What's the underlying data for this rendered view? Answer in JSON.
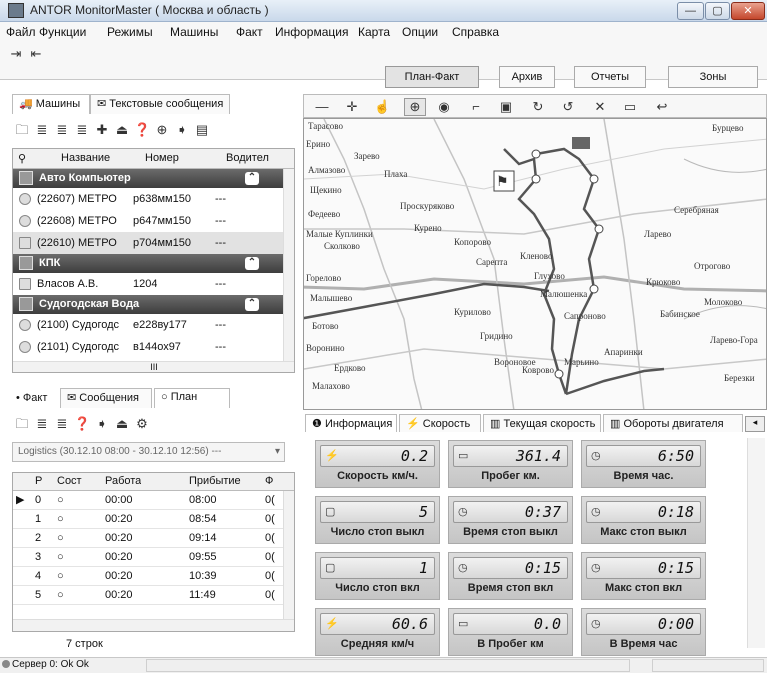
{
  "window": {
    "title": "ANTOR MonitorMaster ( Москва и область )"
  },
  "menu": [
    "Файл",
    "Функции",
    "Режимы",
    "Машины",
    "Факт",
    "Информация",
    "Карта",
    "Опции",
    "Справка"
  ],
  "view_tabs": [
    "План-Факт",
    "Архив",
    "Отчеты",
    "Зоны"
  ],
  "vehicles_panel": {
    "tabs": [
      "Машины",
      "Текстовые сообщения"
    ],
    "columns": [
      "Название",
      "Номер",
      "Водител"
    ],
    "groups": [
      {
        "name": "Авто Компьютер",
        "rows": [
          {
            "name": "(22607) МЕТРО",
            "number": "р638мм150",
            "driver": "---"
          },
          {
            "name": "(22608) МЕТРО",
            "number": "р647мм150",
            "driver": "---"
          },
          {
            "name": "(22610) МЕТРО",
            "number": "р704мм150",
            "driver": "---"
          }
        ]
      },
      {
        "name": "КПК",
        "rows": [
          {
            "name": "Власов А.В.",
            "number": "1204",
            "driver": "---"
          }
        ]
      },
      {
        "name": "Судогодская Вода",
        "rows": [
          {
            "name": "(2100) Судогодс",
            "number": "е228ву177",
            "driver": "---"
          },
          {
            "name": "(2101) Судогодс",
            "number": "в144ох97",
            "driver": "---"
          }
        ]
      }
    ],
    "scroll_marker": "III"
  },
  "plan_panel": {
    "tabs": [
      "Факт",
      "Сообщения",
      "План"
    ],
    "route_select": "Logistics (30.12.10 08:00 - 30.12.10 12:56) ---",
    "columns": [
      "Р",
      "Сост",
      "Работа",
      "Прибытие",
      "Ф"
    ],
    "rows": [
      {
        "p": "0",
        "state": "○",
        "work": "00:00",
        "arrival": "08:00",
        "f": "0("
      },
      {
        "p": "1",
        "state": "○",
        "work": "00:20",
        "arrival": "08:54",
        "f": "0("
      },
      {
        "p": "2",
        "state": "○",
        "work": "00:20",
        "arrival": "09:14",
        "f": "0("
      },
      {
        "p": "3",
        "state": "○",
        "work": "00:20",
        "arrival": "09:55",
        "f": "0("
      },
      {
        "p": "4",
        "state": "○",
        "work": "00:20",
        "arrival": "10:39",
        "f": "0("
      },
      {
        "p": "5",
        "state": "○",
        "work": "00:20",
        "arrival": "11:49",
        "f": "0("
      }
    ],
    "row_count": "7 строк"
  },
  "map": {
    "labels": [
      "Тарасово",
      "Ерино",
      "Алмазово",
      "Щекино",
      "Федеево",
      "Малые Куплинки",
      "Сколково",
      "Горелово",
      "Малышево",
      "Ботово",
      "Воронино",
      "Ердково",
      "Малахово",
      "Зарево",
      "Плаха",
      "Проскуряково",
      "Курено",
      "Копорово",
      "Сарепта",
      "Кленово",
      "Глухово",
      "Малюшенка",
      "Курилово",
      "Гридино",
      "Вороновое",
      "Коврово",
      "Марьино",
      "Сапроново",
      "Апаринки",
      "Крюково",
      "Бабинское",
      "Молоково",
      "Бурцево",
      "Серебряная",
      "Ларево",
      "Отрогово",
      "Ларево-Гора",
      "Березки"
    ]
  },
  "info_panel": {
    "tabs": [
      "Информация",
      "Скорость",
      "Текущая скорость",
      "Обороты двигателя"
    ],
    "metrics": [
      {
        "value": "0.2",
        "label": "Скорость км/ч."
      },
      {
        "value": "361.4",
        "label": "Пробег км."
      },
      {
        "value": "6:50",
        "label": "Время час."
      },
      {
        "value": "5",
        "label": "Число стоп выкл"
      },
      {
        "value": "0:37",
        "label": "Время стоп выкл"
      },
      {
        "value": "0:18",
        "label": "Макс стоп выкл"
      },
      {
        "value": "1",
        "label": "Число стоп вкл"
      },
      {
        "value": "0:15",
        "label": "Время стоп вкл"
      },
      {
        "value": "0:15",
        "label": "Макс стоп вкл"
      },
      {
        "value": "60.6",
        "label": "Средняя км/ч"
      },
      {
        "value": "0.0",
        "label": "В Пробег км"
      },
      {
        "value": "0:00",
        "label": "В Время час"
      }
    ]
  },
  "status": {
    "server": "Сервер 0: Ok Ok"
  }
}
